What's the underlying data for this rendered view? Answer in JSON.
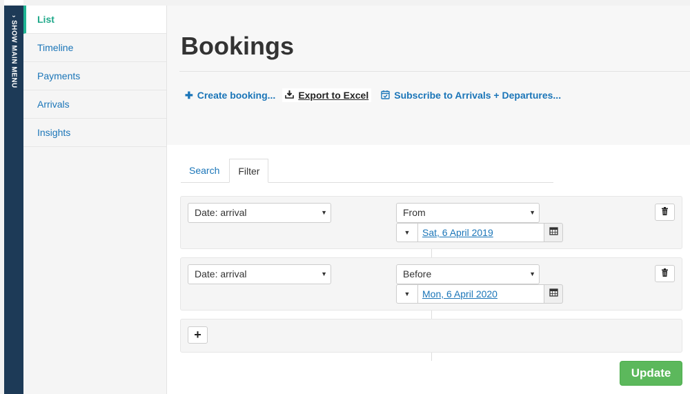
{
  "main_menu": {
    "label": "› SHOW MAIN MENU"
  },
  "subnav": {
    "items": [
      {
        "label": "List",
        "active": true
      },
      {
        "label": "Timeline"
      },
      {
        "label": "Payments"
      },
      {
        "label": "Arrivals"
      },
      {
        "label": "Insights"
      }
    ]
  },
  "page": {
    "title": "Bookings"
  },
  "actions": {
    "create": "Create booking...",
    "export": "Export to Excel",
    "subscribe": "Subscribe to Arrivals + Departures..."
  },
  "tabs": [
    {
      "label": "Search"
    },
    {
      "label": "Filter",
      "active": true
    }
  ],
  "filters": [
    {
      "field": "Date: arrival",
      "operator": "From",
      "date": "Sat, 6 April 2019"
    },
    {
      "field": "Date: arrival",
      "operator": "Before",
      "date": "Mon, 6 April 2020"
    }
  ],
  "add_label": "+",
  "update_label": "Update",
  "colors": {
    "rail": "#1d3a57",
    "link": "#1a75b8",
    "active": "#1fa88a",
    "update": "#5cb85c"
  }
}
